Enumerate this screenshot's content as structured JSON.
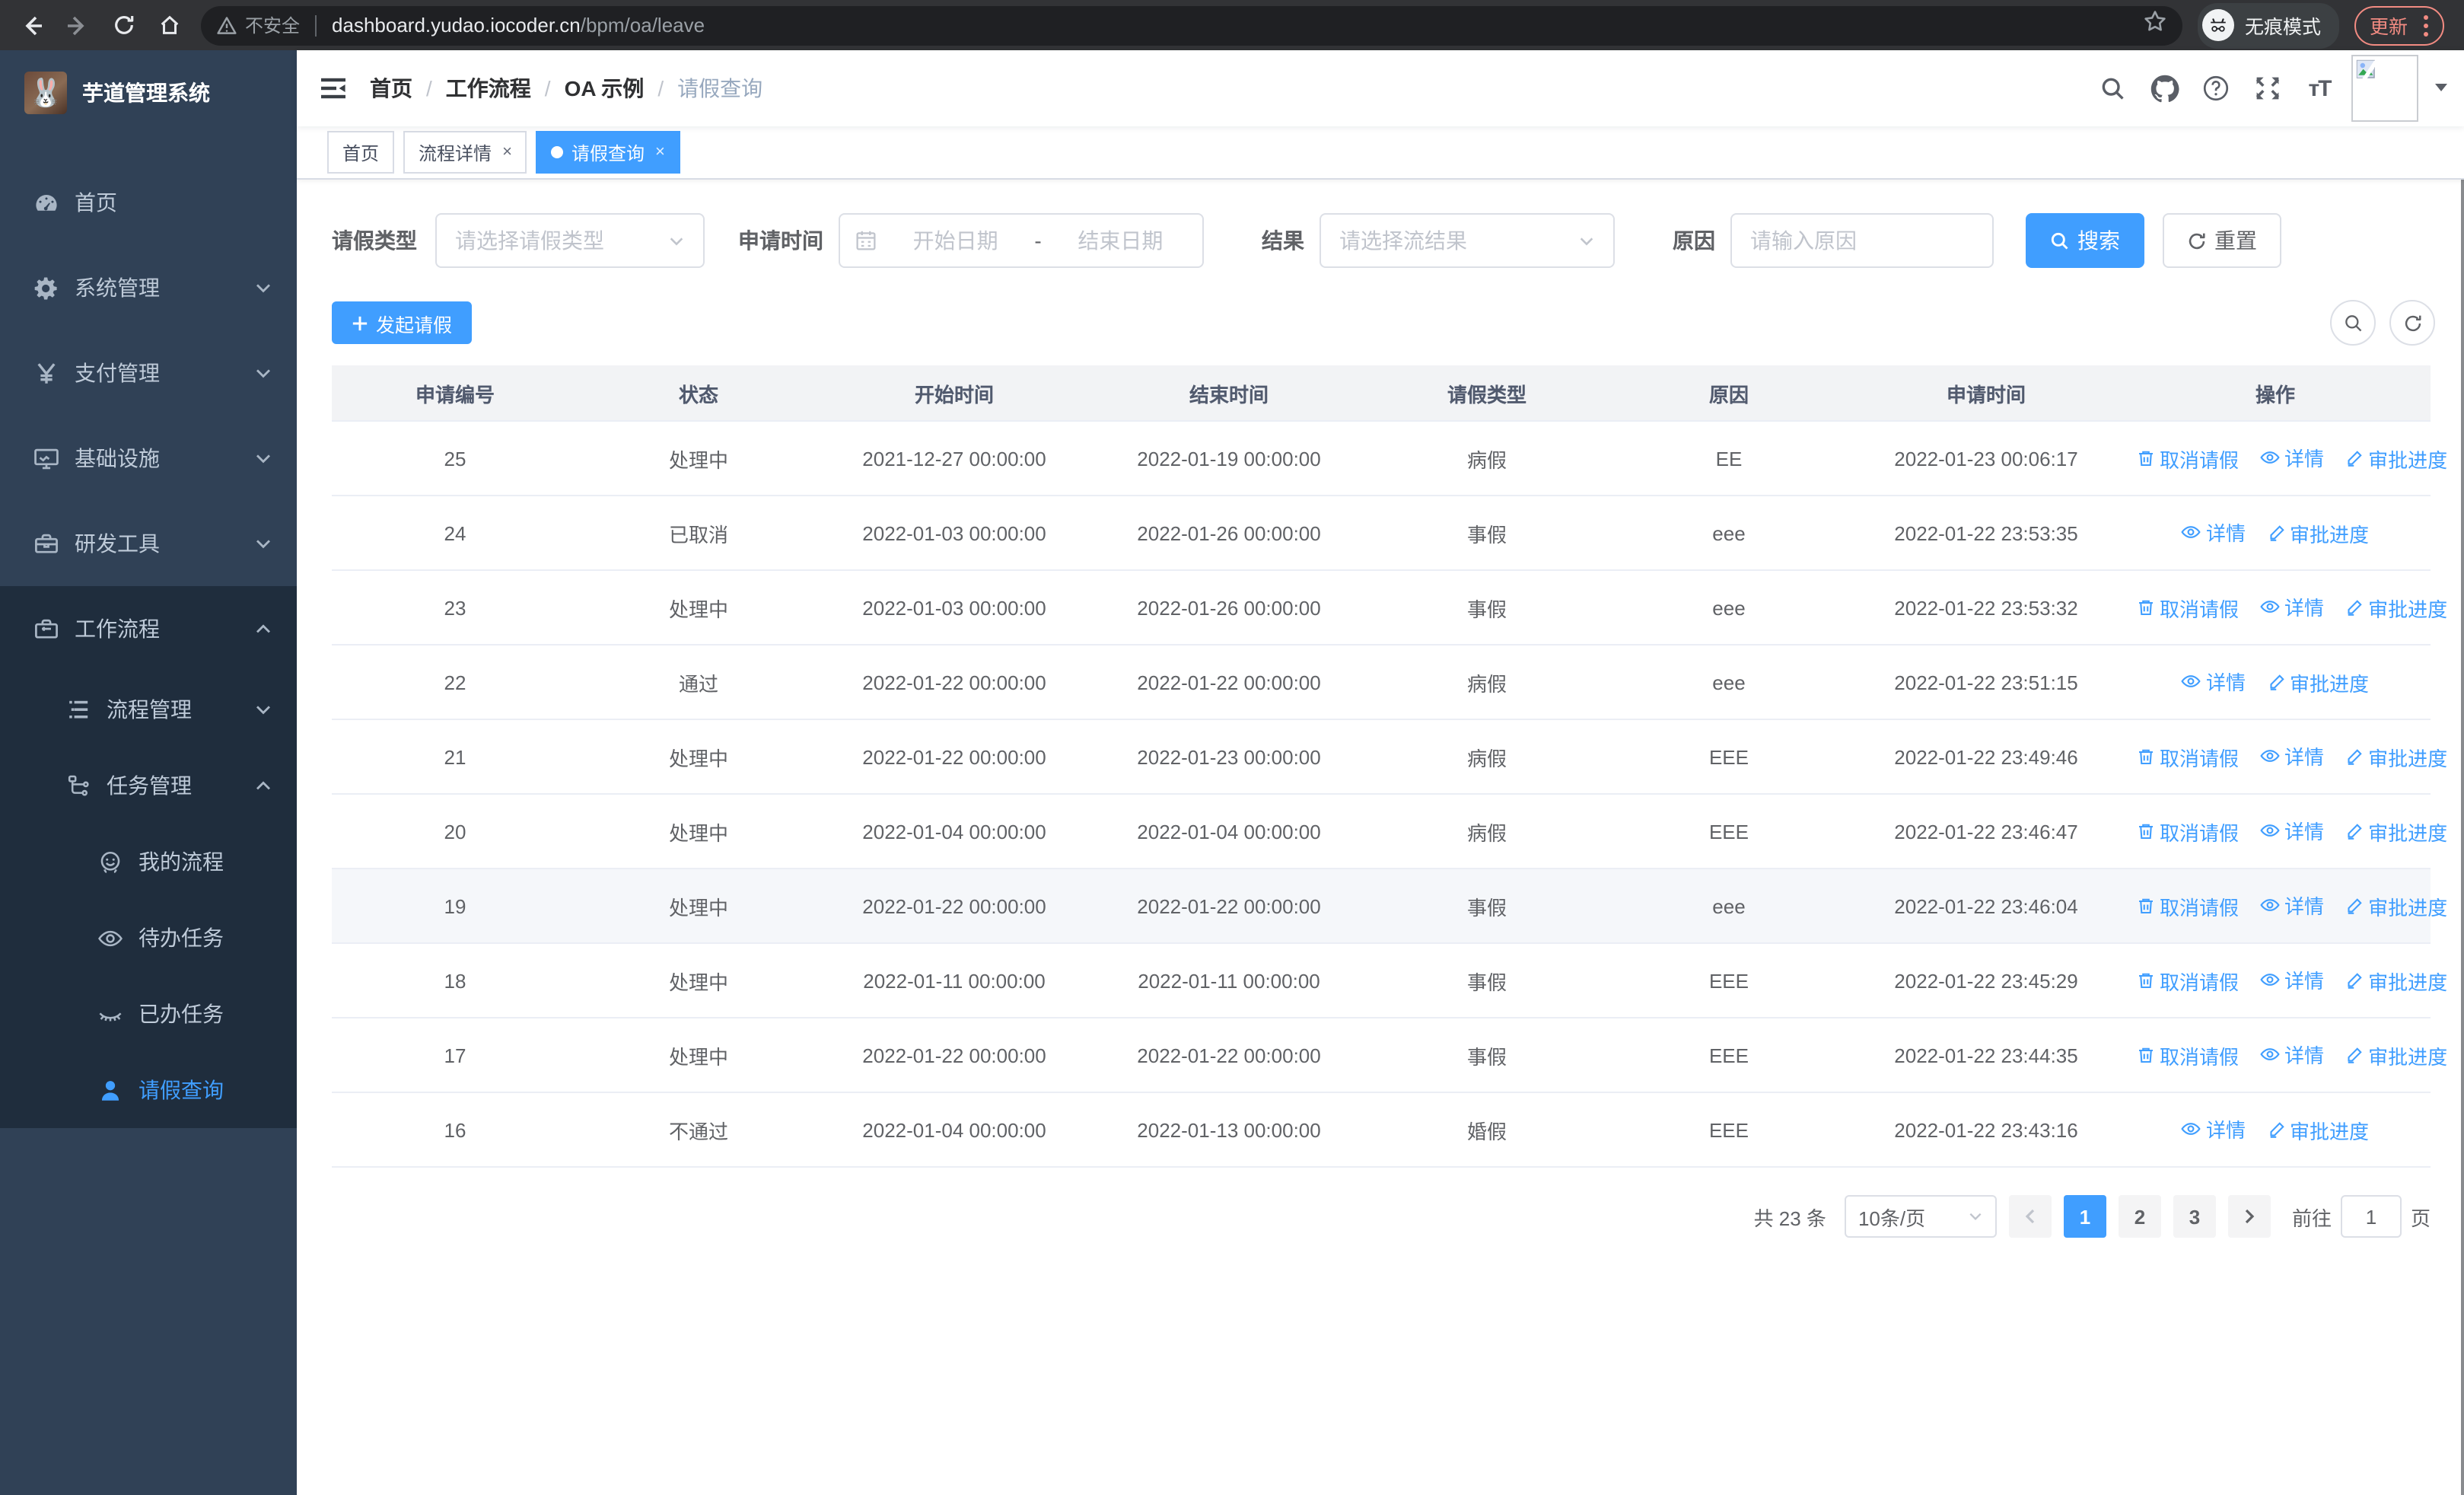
{
  "browser": {
    "security_label": "不安全",
    "url_host": "dashboard.yudao.iocoder.cn",
    "url_path": "/bpm/oa/leave",
    "incognito_label": "无痕模式",
    "update_label": "更新"
  },
  "sidebar": {
    "app_title": "芋道管理系统",
    "menu": [
      {
        "label": "首页",
        "icon": "dashboard-icon",
        "level": 1,
        "sub": false,
        "chevron": "",
        "active": false
      },
      {
        "label": "系统管理",
        "icon": "gear-icon",
        "level": 1,
        "sub": false,
        "chevron": "down",
        "active": false
      },
      {
        "label": "支付管理",
        "icon": "yuan-icon",
        "level": 1,
        "sub": false,
        "chevron": "down",
        "active": false
      },
      {
        "label": "基础设施",
        "icon": "monitor-icon",
        "level": 1,
        "sub": false,
        "chevron": "down",
        "active": false
      },
      {
        "label": "研发工具",
        "icon": "toolbox-icon",
        "level": 1,
        "sub": false,
        "chevron": "down",
        "active": false
      },
      {
        "label": "工作流程",
        "icon": "briefcase-icon",
        "level": 1,
        "sub": true,
        "chevron": "up",
        "active": false
      },
      {
        "label": "流程管理",
        "icon": "tree-icon",
        "level": 2,
        "sub": true,
        "chevron": "down",
        "active": false
      },
      {
        "label": "任务管理",
        "icon": "flow-icon",
        "level": 2,
        "sub": true,
        "chevron": "up",
        "active": false
      },
      {
        "label": "我的流程",
        "icon": "people-icon",
        "level": 3,
        "sub": true,
        "chevron": "",
        "active": false
      },
      {
        "label": "待办任务",
        "icon": "eye-open-icon",
        "level": 3,
        "sub": true,
        "chevron": "",
        "active": false
      },
      {
        "label": "已办任务",
        "icon": "eye-closed-icon",
        "level": 3,
        "sub": true,
        "chevron": "",
        "active": false
      },
      {
        "label": "请假查询",
        "icon": "user-icon",
        "level": 3,
        "sub": true,
        "chevron": "",
        "active": true
      }
    ]
  },
  "header": {
    "breadcrumb": [
      "首页",
      "工作流程",
      "OA 示例",
      "请假查询"
    ]
  },
  "tabs": [
    {
      "label": "首页",
      "active": false,
      "closable": false
    },
    {
      "label": "流程详情",
      "active": false,
      "closable": true
    },
    {
      "label": "请假查询",
      "active": true,
      "closable": true
    }
  ],
  "filters": {
    "type_label": "请假类型",
    "type_placeholder": "请选择请假类型",
    "time_label": "申请时间",
    "start_placeholder": "开始日期",
    "range_separator": "-",
    "end_placeholder": "结束日期",
    "result_label": "结果",
    "result_placeholder": "请选择流结果",
    "reason_label": "原因",
    "reason_placeholder": "请输入原因",
    "search_label": "搜索",
    "reset_label": "重置"
  },
  "toolbar": {
    "create_label": "发起请假"
  },
  "table": {
    "columns": [
      "申请编号",
      "状态",
      "开始时间",
      "结束时间",
      "请假类型",
      "原因",
      "申请时间",
      "操作"
    ],
    "action_labels": {
      "cancel": "取消请假",
      "detail": "详情",
      "progress": "审批进度"
    },
    "rows": [
      {
        "id": "25",
        "status": "处理中",
        "start": "2021-12-27 00:00:00",
        "end": "2022-01-19 00:00:00",
        "type": "病假",
        "reason": "EE",
        "applied": "2022-01-23 00:06:17",
        "actions": [
          "cancel",
          "detail",
          "progress"
        ],
        "highlight": false
      },
      {
        "id": "24",
        "status": "已取消",
        "start": "2022-01-03 00:00:00",
        "end": "2022-01-26 00:00:00",
        "type": "事假",
        "reason": "eee",
        "applied": "2022-01-22 23:53:35",
        "actions": [
          "detail",
          "progress"
        ],
        "highlight": false
      },
      {
        "id": "23",
        "status": "处理中",
        "start": "2022-01-03 00:00:00",
        "end": "2022-01-26 00:00:00",
        "type": "事假",
        "reason": "eee",
        "applied": "2022-01-22 23:53:32",
        "actions": [
          "cancel",
          "detail",
          "progress"
        ],
        "highlight": false
      },
      {
        "id": "22",
        "status": "通过",
        "start": "2022-01-22 00:00:00",
        "end": "2022-01-22 00:00:00",
        "type": "病假",
        "reason": "eee",
        "applied": "2022-01-22 23:51:15",
        "actions": [
          "detail",
          "progress"
        ],
        "highlight": false
      },
      {
        "id": "21",
        "status": "处理中",
        "start": "2022-01-22 00:00:00",
        "end": "2022-01-23 00:00:00",
        "type": "病假",
        "reason": "EEE",
        "applied": "2022-01-22 23:49:46",
        "actions": [
          "cancel",
          "detail",
          "progress"
        ],
        "highlight": false
      },
      {
        "id": "20",
        "status": "处理中",
        "start": "2022-01-04 00:00:00",
        "end": "2022-01-04 00:00:00",
        "type": "病假",
        "reason": "EEE",
        "applied": "2022-01-22 23:46:47",
        "actions": [
          "cancel",
          "detail",
          "progress"
        ],
        "highlight": false
      },
      {
        "id": "19",
        "status": "处理中",
        "start": "2022-01-22 00:00:00",
        "end": "2022-01-22 00:00:00",
        "type": "事假",
        "reason": "eee",
        "applied": "2022-01-22 23:46:04",
        "actions": [
          "cancel",
          "detail",
          "progress"
        ],
        "highlight": true
      },
      {
        "id": "18",
        "status": "处理中",
        "start": "2022-01-11 00:00:00",
        "end": "2022-01-11 00:00:00",
        "type": "事假",
        "reason": "EEE",
        "applied": "2022-01-22 23:45:29",
        "actions": [
          "cancel",
          "detail",
          "progress"
        ],
        "highlight": false
      },
      {
        "id": "17",
        "status": "处理中",
        "start": "2022-01-22 00:00:00",
        "end": "2022-01-22 00:00:00",
        "type": "事假",
        "reason": "EEE",
        "applied": "2022-01-22 23:44:35",
        "actions": [
          "cancel",
          "detail",
          "progress"
        ],
        "highlight": false
      },
      {
        "id": "16",
        "status": "不通过",
        "start": "2022-01-04 00:00:00",
        "end": "2022-01-13 00:00:00",
        "type": "婚假",
        "reason": "EEE",
        "applied": "2022-01-22 23:43:16",
        "actions": [
          "detail",
          "progress"
        ],
        "highlight": false
      }
    ]
  },
  "pagination": {
    "total_label": "共 23 条",
    "page_size_label": "10条/页",
    "pages": [
      "1",
      "2",
      "3"
    ],
    "current_page": "1",
    "goto_label": "前往",
    "goto_value": "1",
    "page_unit_label": "页"
  },
  "colors": {
    "accent": "#409eff",
    "sidebar_bg": "#304156",
    "submenu_bg": "#1f2d3d",
    "active_tab_bg": "#409eff",
    "update_pill": "#f28b82"
  }
}
